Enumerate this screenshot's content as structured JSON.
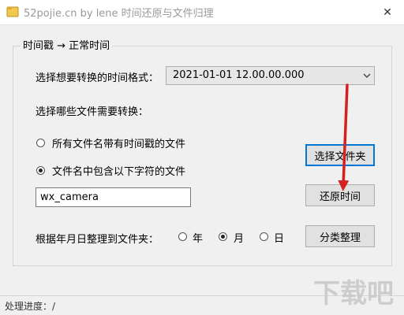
{
  "window": {
    "title": "52pojie.cn by lene 时间还原与文件归理",
    "close_glyph": "✕",
    "app_icon": "app-icon",
    "close_icon": "close-icon"
  },
  "group": {
    "title": "时间戳 → 正常时间"
  },
  "format": {
    "label": "选择想要转换的时间格式：",
    "selected": "2021-01-01 12.00.00.000",
    "arrow_glyph": "⌄"
  },
  "files": {
    "label": "选择哪些文件需要转换：",
    "option_all": "所有文件名带有时间戳的文件",
    "option_contains": "文件名中包含以下字符的文件",
    "selected_option": "contains",
    "keyword_value": "wx_camera"
  },
  "buttons": {
    "select_folder": "选择文件夹",
    "restore_time": "还原时间",
    "classify": "分类整理"
  },
  "organize": {
    "label": "根据年月日整理到文件夹：",
    "year": "年",
    "month": "月",
    "day": "日",
    "selected": "month"
  },
  "status": {
    "text": "处理进度：/"
  },
  "watermark": {
    "text": "下载吧"
  },
  "colors": {
    "focus_border": "#0078d7",
    "annotation_arrow": "#d42020"
  }
}
